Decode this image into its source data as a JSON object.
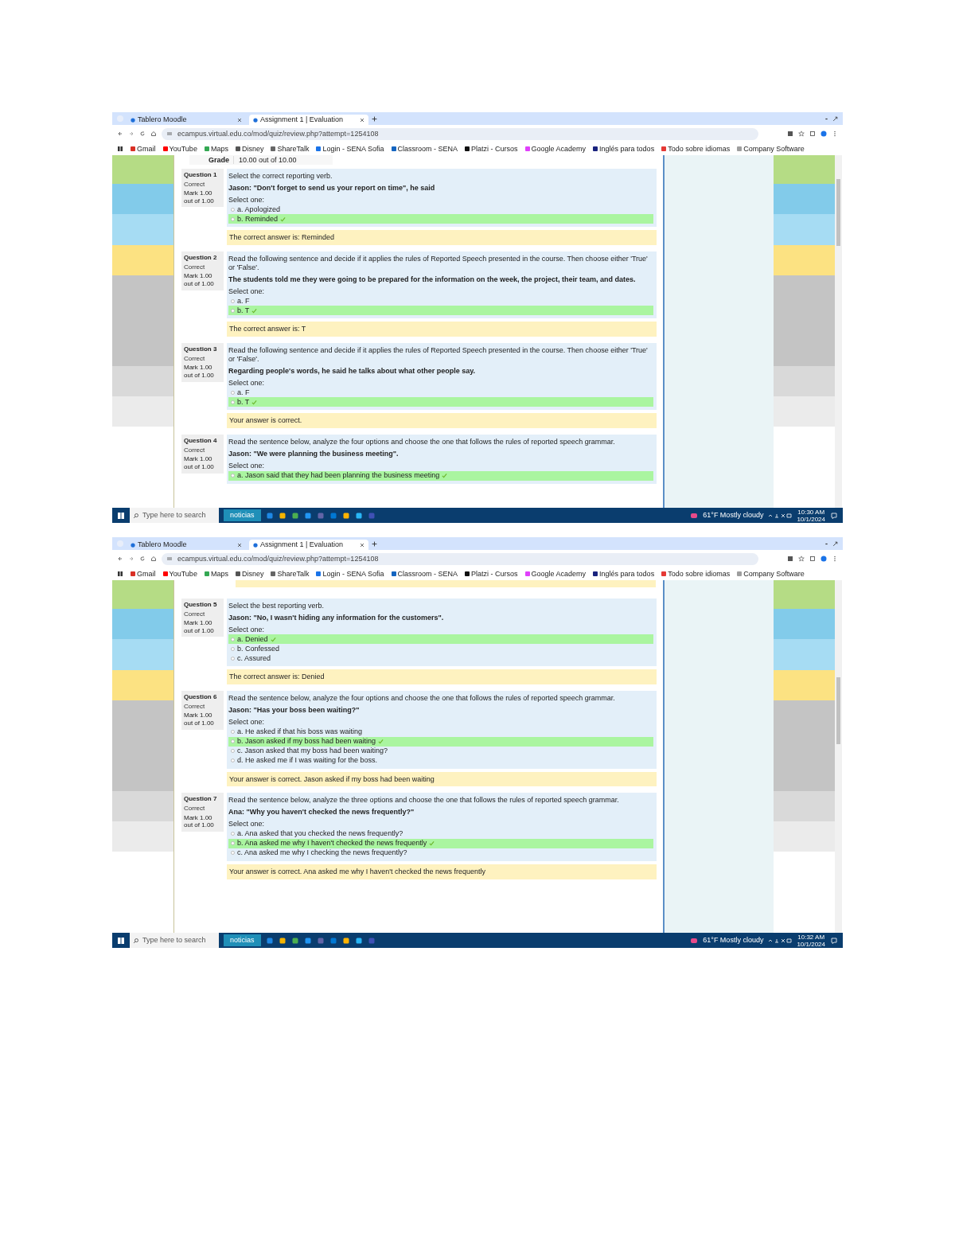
{
  "screenshots": [
    {
      "tabs": [
        {
          "label": "Tablero Moodle",
          "selected": false
        },
        {
          "label": "Assignment 1 | Evaluation",
          "selected": true
        }
      ],
      "url": "ecampus.virtual.edu.co/mod/quiz/review.php?attempt=1254108",
      "bookmarks": [
        {
          "label": "Gmail",
          "color": "#d93025"
        },
        {
          "label": "YouTube",
          "color": "#ff0000"
        },
        {
          "label": "Maps",
          "color": "#34a853"
        },
        {
          "label": "Disney",
          "color": "#555555"
        },
        {
          "label": "ShareTalk",
          "color": "#666666"
        },
        {
          "label": "Login - SENA Sofia",
          "color": "#1a73e8"
        },
        {
          "label": "Classroom - SENA",
          "color": "#1565c0"
        },
        {
          "label": "Platzi - Cursos",
          "color": "#111111"
        },
        {
          "label": "Google Academy",
          "color": "#e040fb"
        },
        {
          "label": "Inglés para todos",
          "color": "#1a237e"
        },
        {
          "label": "Todo sobre idiomas",
          "color": "#e53935"
        },
        {
          "label": "Company Software",
          "color": "#9e9e9e"
        }
      ],
      "grade": {
        "label": "Grade",
        "value": "10.00 out of 10.00"
      },
      "cut_feedback": false,
      "questions": [
        {
          "number": "Question 1",
          "status": "Correct",
          "mark": "Mark 1.00 out of 1.00",
          "prompt": "Select the correct reporting verb.",
          "quote": "Jason: \"Don't forget to send us your report on time\", he said",
          "select_label": "Select one:",
          "options": [
            {
              "text": "a. Apologized",
              "selected": false
            },
            {
              "text": "b. Reminded",
              "selected": true
            }
          ],
          "feedback": "The correct answer is: Reminded"
        },
        {
          "number": "Question 2",
          "status": "Correct",
          "mark": "Mark 1.00 out of 1.00",
          "prompt": "Read the following sentence and decide if it applies the rules of Reported Speech presented in the course. Then choose either 'True' or 'False'.",
          "quote": "The students told me they were going to be prepared for the information on the week, the project, their team, and dates.",
          "select_label": "Select one:",
          "options": [
            {
              "text": "a. F",
              "selected": false
            },
            {
              "text": "b. T",
              "selected": true
            }
          ],
          "feedback": "The correct answer is: T"
        },
        {
          "number": "Question 3",
          "status": "Correct",
          "mark": "Mark 1.00 out of 1.00",
          "prompt": "Read the following sentence and decide if it applies the rules of Reported Speech presented in the course. Then choose either 'True' or 'False'.",
          "quote": "Regarding people's words, he said he talks about what other people say.",
          "select_label": "Select one:",
          "options": [
            {
              "text": "a. F",
              "selected": false
            },
            {
              "text": "b. T",
              "selected": true
            }
          ],
          "feedback": "Your answer is correct."
        },
        {
          "number": "Question 4",
          "status": "Correct",
          "mark": "Mark 1.00 out of 1.00",
          "prompt": "Read the sentence below, analyze the four options and choose the one that follows the rules of reported speech grammar.",
          "quote": "Jason: \"We were planning the business meeting\".",
          "select_label": "Select one:",
          "options": [
            {
              "text": "a. Jason said that they had been planning the business meeting",
              "selected": true
            }
          ]
        }
      ],
      "taskbar": {
        "search": "Type here to search",
        "news": "noticias",
        "weather": "61°F Mostly cloudy",
        "time": "10:30 AM",
        "date": "10/1/2024"
      }
    },
    {
      "tabs": [
        {
          "label": "Tablero Moodle",
          "selected": false
        },
        {
          "label": "Assignment 1 | Evaluation",
          "selected": true
        }
      ],
      "url": "ecampus.virtual.edu.co/mod/quiz/review.php?attempt=1254108",
      "bookmarks": [
        {
          "label": "Gmail",
          "color": "#d93025"
        },
        {
          "label": "YouTube",
          "color": "#ff0000"
        },
        {
          "label": "Maps",
          "color": "#34a853"
        },
        {
          "label": "Disney",
          "color": "#555555"
        },
        {
          "label": "ShareTalk",
          "color": "#666666"
        },
        {
          "label": "Login - SENA Sofia",
          "color": "#1a73e8"
        },
        {
          "label": "Classroom - SENA",
          "color": "#1565c0"
        },
        {
          "label": "Platzi - Cursos",
          "color": "#111111"
        },
        {
          "label": "Google Academy",
          "color": "#e040fb"
        },
        {
          "label": "Inglés para todos",
          "color": "#1a237e"
        },
        {
          "label": "Todo sobre idiomas",
          "color": "#e53935"
        },
        {
          "label": "Company Software",
          "color": "#9e9e9e"
        }
      ],
      "cut_feedback": true,
      "questions": [
        {
          "number": "Question 5",
          "status": "Correct",
          "mark": "Mark 1.00 out of 1.00",
          "prompt": "Select the best reporting verb.",
          "quote": "Jason: \"No, I wasn't hiding any information for the customers\".",
          "select_label": "Select one:",
          "options": [
            {
              "text": "a. Denied",
              "selected": true
            },
            {
              "text": "b. Confessed",
              "selected": false
            },
            {
              "text": "c. Assured",
              "selected": false
            }
          ],
          "feedback": "The correct answer is: Denied"
        },
        {
          "number": "Question 6",
          "status": "Correct",
          "mark": "Mark 1.00 out of 1.00",
          "prompt": "Read the sentence below, analyze the four options and choose the one that follows the rules of reported speech grammar.",
          "quote": "Jason: \"Has your boss been waiting?\"",
          "select_label": "Select one:",
          "options": [
            {
              "text": "a. He asked if that his boss was waiting",
              "selected": false
            },
            {
              "text": "b. Jason asked if my boss had been waiting",
              "selected": true
            },
            {
              "text": "c. Jason asked that my boss had been waiting?",
              "selected": false
            },
            {
              "text": "d. He asked me if I was waiting for the boss.",
              "selected": false
            }
          ],
          "feedback": "Your answer is correct. Jason asked if my boss had been waiting"
        },
        {
          "number": "Question 7",
          "status": "Correct",
          "mark": "Mark 1.00 out of 1.00",
          "prompt": "Read the sentence below, analyze the three options and choose the one that follows the rules of reported speech grammar.",
          "quote": "Ana: \"Why you haven't checked the news frequently?\"",
          "select_label": "Select one:",
          "options": [
            {
              "text": "a. Ana asked that you checked the news frequently?",
              "selected": false
            },
            {
              "text": "b. Ana asked me why I haven't checked the news frequently",
              "selected": true
            },
            {
              "text": "c. Ana asked me why I checking the news frequently?",
              "selected": false
            }
          ],
          "feedback": "Your answer is correct. Ana asked me why I haven't checked the news frequently"
        }
      ],
      "taskbar": {
        "search": "Type here to search",
        "news": "noticias",
        "weather": "61°F Mostly cloudy",
        "time": "10:32 AM",
        "date": "10/1/2024"
      }
    }
  ]
}
